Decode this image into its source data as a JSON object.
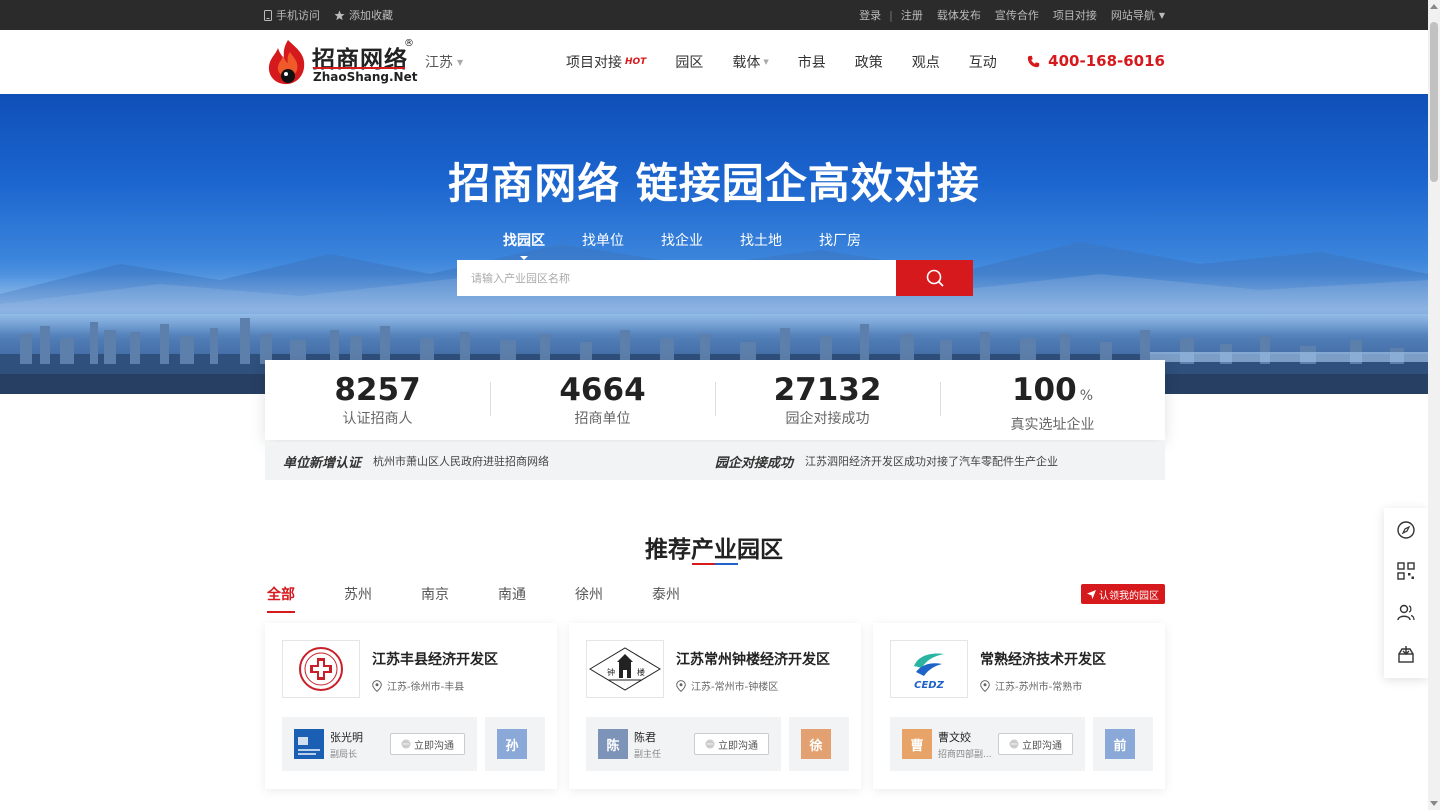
{
  "topbar": {
    "mobile_label": "手机访问",
    "favorite_label": "添加收藏",
    "login": "登录",
    "separator": "|",
    "register": "注册",
    "links": [
      "载体发布",
      "宣传合作",
      "项目对接"
    ],
    "site_nav": "网站导航"
  },
  "header": {
    "logo_cn": "招商网络",
    "logo_reg": "®",
    "logo_en": "ZhaoShang.Net",
    "region": "江苏",
    "nav": [
      {
        "label": "项目对接",
        "badge": "HOT"
      },
      {
        "label": "园区"
      },
      {
        "label": "载体"
      },
      {
        "label": "市县"
      },
      {
        "label": "政策"
      },
      {
        "label": "观点"
      },
      {
        "label": "互动"
      }
    ],
    "phone": "400-168-6016"
  },
  "hero": {
    "title": "招商网络 链接园企高效对接",
    "tabs": [
      "找园区",
      "找单位",
      "找企业",
      "找土地",
      "找厂房"
    ],
    "active_tab": 0,
    "search_placeholder": "请输入产业园区名称"
  },
  "stats": [
    {
      "num": "8257",
      "unit": "",
      "label": "认证招商人"
    },
    {
      "num": "4664",
      "unit": "",
      "label": "招商单位"
    },
    {
      "num": "27132",
      "unit": "",
      "label": "园企对接成功"
    },
    {
      "num": "100",
      "unit": "%",
      "label": "真实选址企业"
    }
  ],
  "ticker": {
    "tag1": "单位新增认证",
    "text1": "杭州市萧山区人民政府进驻招商网络",
    "tag2": "园企对接成功",
    "text2": "江苏泗阳经济开发区成功对接了汽车零配件生产企业"
  },
  "section": {
    "title": "推荐产业园区",
    "tabs": [
      "全部",
      "苏州",
      "南京",
      "南通",
      "徐州",
      "泰州"
    ],
    "active_tab": 0,
    "claim_label": "认领我的园区"
  },
  "cards": [
    {
      "name": "江苏丰县经济开发区",
      "location": "江苏-徐州市-丰县",
      "logo_icon": "fengxian-emblem-icon",
      "contact": {
        "name": "张光明",
        "role": "副局长",
        "chat": "立即沟通",
        "avatar_text": ""
      },
      "contact2_avatar": "孙",
      "colors": {
        "avatar": "#1a5fb4",
        "avatar2": "#8aa8d8"
      }
    },
    {
      "name": "江苏常州钟楼经济开发区",
      "location": "江苏-常州市-钟楼区",
      "logo_icon": "zhonglou-tower-icon",
      "logo_text_left": "钟",
      "logo_text_right": "楼",
      "contact": {
        "name": "陈君",
        "role": "副主任",
        "chat": "立即沟通",
        "avatar_text": "陈"
      },
      "contact2_avatar": "徐",
      "colors": {
        "avatar": "#7d93b8",
        "avatar2": "#e3a070"
      }
    },
    {
      "name": "常熟经济技术开发区",
      "location": "江苏-苏州市-常熟市",
      "logo_icon": "cedz-logo-icon",
      "logo_text": "CEDZ",
      "contact": {
        "name": "曹文姣",
        "role": "招商四部副...",
        "chat": "立即沟通",
        "avatar_text": "曹"
      },
      "contact2_avatar": "前",
      "colors": {
        "avatar": "#e8a468",
        "avatar2": "#8aa8d8"
      }
    }
  ],
  "colors": {
    "brand_red": "#d6191c",
    "brand_blue": "#1e63c8",
    "topbar_bg": "#2b2b2b"
  }
}
